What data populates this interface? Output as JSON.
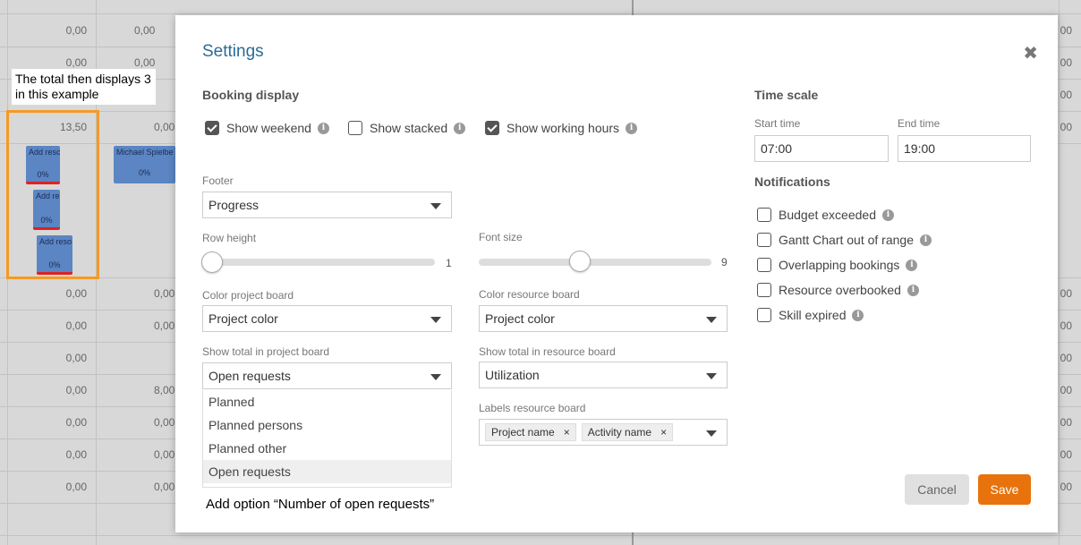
{
  "background": {
    "note": "The total then displays 3 in this example",
    "col1_values": [
      "0,00",
      "0,00",
      "13,50",
      "0,00",
      "0,00",
      "0,00",
      "0,00",
      "0,00",
      "0,00",
      "0,00"
    ],
    "col2_values": [
      "0,00",
      "0,00",
      "0,00",
      "0,00",
      "0,00",
      "8,00",
      "0,00",
      "0,00",
      "0,00"
    ],
    "right_values": [
      "00",
      "00",
      "00",
      "00",
      "00",
      "00",
      "00",
      "00",
      "00",
      "00",
      "00",
      "00",
      "00"
    ],
    "bookings": [
      {
        "label": "Add resc",
        "pct": "0%"
      },
      {
        "label": "Add re",
        "pct": "0%"
      },
      {
        "label": "Add reso",
        "pct": "0%"
      },
      {
        "label": "Michael Spielbe",
        "pct": "0%"
      }
    ]
  },
  "modal": {
    "title": "Settings",
    "booking_display": {
      "title": "Booking display",
      "checkboxes": [
        {
          "label": "Show weekend",
          "checked": true
        },
        {
          "label": "Show stacked",
          "checked": false
        },
        {
          "label": "Show working hours",
          "checked": true
        }
      ]
    },
    "footer": {
      "label": "Footer",
      "value": "Progress"
    },
    "row_height": {
      "label": "Row height",
      "value": "1",
      "fraction": 0.0
    },
    "font_size": {
      "label": "Font size",
      "value": "9",
      "fraction": 0.43
    },
    "color_project_board": {
      "label": "Color project board",
      "value": "Project color"
    },
    "color_resource_board": {
      "label": "Color resource board",
      "value": "Project color"
    },
    "show_total_project": {
      "label": "Show total in project board",
      "value": "Open requests",
      "options": [
        "Planned",
        "Planned persons",
        "Planned other",
        "Open requests"
      ]
    },
    "show_total_resource": {
      "label": "Show total in resource board",
      "value": "Utilization"
    },
    "labels_resource": {
      "label": "Labels resource board",
      "tags": [
        "Project name",
        "Activity name"
      ],
      "tag_remove": "×"
    },
    "time_scale": {
      "title": "Time scale",
      "start_label": "Start time",
      "start_value": "07:00",
      "end_label": "End time",
      "end_value": "19:00"
    },
    "notifications": {
      "title": "Notifications",
      "items": [
        {
          "label": "Budget exceeded",
          "checked": false
        },
        {
          "label": "Gantt Chart out of range",
          "checked": false
        },
        {
          "label": "Overlapping bookings",
          "checked": false
        },
        {
          "label": "Resource overbooked",
          "checked": false
        },
        {
          "label": "Skill expired",
          "checked": false
        }
      ]
    },
    "annotation": "Add option “Number of open requests”",
    "cancel_label": "Cancel",
    "save_label": "Save",
    "close_glyph": "✖",
    "info_glyph": "i"
  },
  "colors": {
    "accent": "#e8730c",
    "title": "#2a6b99",
    "highlight": "#f59a23"
  }
}
